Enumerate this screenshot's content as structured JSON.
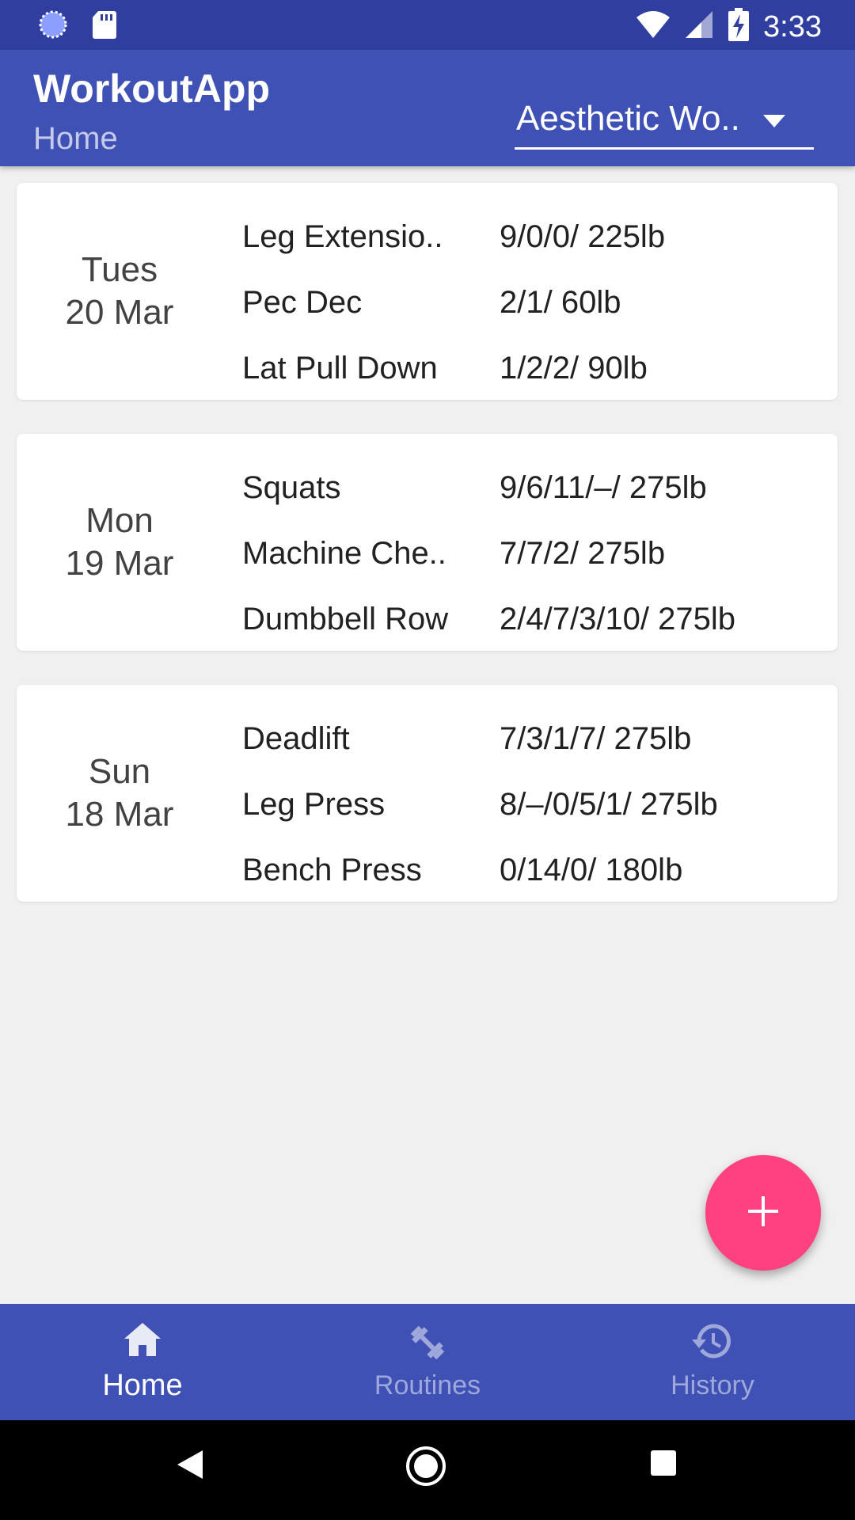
{
  "status_bar": {
    "time": "3:33",
    "icons": [
      "sync-icon",
      "sd-card-icon",
      "wifi-icon",
      "signal-icon",
      "battery-charging-icon"
    ]
  },
  "app_bar": {
    "title": "WorkoutApp",
    "subtitle": "Home",
    "routine_selector": {
      "value": "Aesthetic Wo..",
      "icon": "dropdown-arrow-icon"
    }
  },
  "workouts": [
    {
      "day": "Tues",
      "date": "20 Mar",
      "exercises": [
        {
          "name": "Leg Extensio..",
          "sets": "9/0/0/  225lb"
        },
        {
          "name": "Pec Dec",
          "sets": "2/1/  60lb"
        },
        {
          "name": "Lat Pull Down",
          "sets": "1/2/2/  90lb"
        }
      ]
    },
    {
      "day": "Mon",
      "date": "19 Mar",
      "exercises": [
        {
          "name": "Squats",
          "sets": "9/6/11/–/  275lb"
        },
        {
          "name": "Machine Che..",
          "sets": "7/7/2/  275lb"
        },
        {
          "name": "Dumbbell Row",
          "sets": "2/4/7/3/10/  275lb"
        }
      ]
    },
    {
      "day": "Sun",
      "date": "18 Mar",
      "exercises": [
        {
          "name": "Deadlift",
          "sets": "7/3/1/7/  275lb"
        },
        {
          "name": "Leg Press",
          "sets": "8/–/0/5/1/  275lb"
        },
        {
          "name": "Bench Press",
          "sets": "0/14/0/  180lb"
        }
      ]
    }
  ],
  "fab": {
    "icon": "plus-icon"
  },
  "bottom_nav": {
    "items": [
      {
        "label": "Home",
        "icon": "home-icon",
        "active": true
      },
      {
        "label": "Routines",
        "icon": "dumbbell-icon",
        "active": false
      },
      {
        "label": "History",
        "icon": "history-icon",
        "active": false
      }
    ]
  },
  "colors": {
    "primary": "#3f51b5",
    "primary_dark": "#303f9f",
    "accent": "#ff4081",
    "background": "#f0f0f0"
  }
}
